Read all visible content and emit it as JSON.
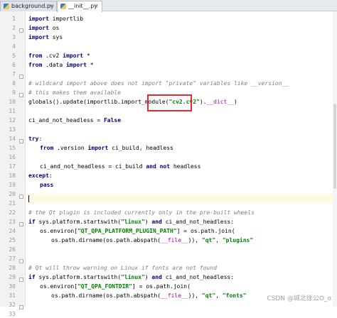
{
  "tabs": [
    {
      "label": "background.py",
      "active": false
    },
    {
      "label": "__init__.py",
      "active": true
    }
  ],
  "line_numbers": [
    "1",
    "2",
    "3",
    "4",
    "5",
    "6",
    "7",
    "8",
    "9",
    "10",
    "11",
    "12",
    "13",
    "14",
    "15",
    "16",
    "17",
    "18",
    "19",
    "20",
    "21",
    "22",
    "23",
    "24",
    "25",
    "26",
    "27",
    "28",
    "29",
    "30",
    "31",
    "32",
    "33"
  ],
  "code": {
    "l1_kw": "import",
    "l1_rest": " importlib",
    "l2_kw": "import",
    "l2_rest": " os",
    "l3_kw": "import",
    "l3_rest": " sys",
    "l5_kw1": "from",
    "l5_mid": " .cv2 ",
    "l5_kw2": "import",
    "l5_rest": " *",
    "l6_kw1": "from",
    "l6_mid": " .data ",
    "l6_kw2": "import",
    "l6_rest": " *",
    "l8": "# wildcard import above does not import \"private\" variables like __version__",
    "l9": "# this makes them available",
    "l10_a": "globals().update(importlib.import_module(",
    "l10_str": "\"cv2.cv2\"",
    "l10_b": ").",
    "l10_dun": "__dict__",
    "l10_c": ")",
    "l12_a": "ci_and_not_headless = ",
    "l12_kw": "False",
    "l14_kw": "try",
    "l14_rest": ":",
    "l15_kw1": "from",
    "l15_mid": " .version ",
    "l15_kw2": "import",
    "l15_rest": " ci_build, headless",
    "l17_a": "ci_and_not_headless = ci_build ",
    "l17_kw1": "and",
    "l17_kw2": "not",
    "l17_rest": " headless",
    "l18_kw": "except",
    "l18_rest": ":",
    "l19_kw": "pass",
    "l22": "# the Qt plugin is included currently only in the pre-built wheels",
    "l23_kw": "if",
    "l23_a": " sys.platform.startswith(",
    "l23_str": "\"linux\"",
    "l23_b": ") ",
    "l23_kw2": "and",
    "l23_c": " ci_and_not_headless:",
    "l24_a": "os.environ[",
    "l24_str": "\"QT_QPA_PLATFORM_PLUGIN_PATH\"",
    "l24_b": "] = os.path.join(",
    "l25_a": "os.path.dirname(os.path.abspath(",
    "l25_dun": "__file__",
    "l25_b": ")), ",
    "l25_str1": "\"qt\"",
    "l25_c": ", ",
    "l25_str2": "\"plugins\"",
    "l28": "# Qt will throw warning on Linux if fonts are not found",
    "l29_kw": "if",
    "l29_a": " sys.platform.startswith(",
    "l29_str": "\"linux\"",
    "l29_b": ") ",
    "l29_kw2": "and",
    "l29_c": " ci_and_not_headless:",
    "l30_a": "os.environ[",
    "l30_str": "\"QT_QPA_FONTDIR\"",
    "l30_b": "] = os.path.join(",
    "l31_a": "os.path.dirname(os.path.abspath(",
    "l31_dun": "__file__",
    "l31_b": ")), ",
    "l31_str1": "\"qt\"",
    "l31_c": ", ",
    "l31_str2": "\"fonts\""
  },
  "watermark": "CSDN @城北徐公O_o",
  "colors": {
    "keyword": "#000080",
    "string": "#008000",
    "comment": "#808080",
    "dunder": "#b200b2",
    "highlight_box": "#e52b2b",
    "caret_line": "#fffae3"
  }
}
